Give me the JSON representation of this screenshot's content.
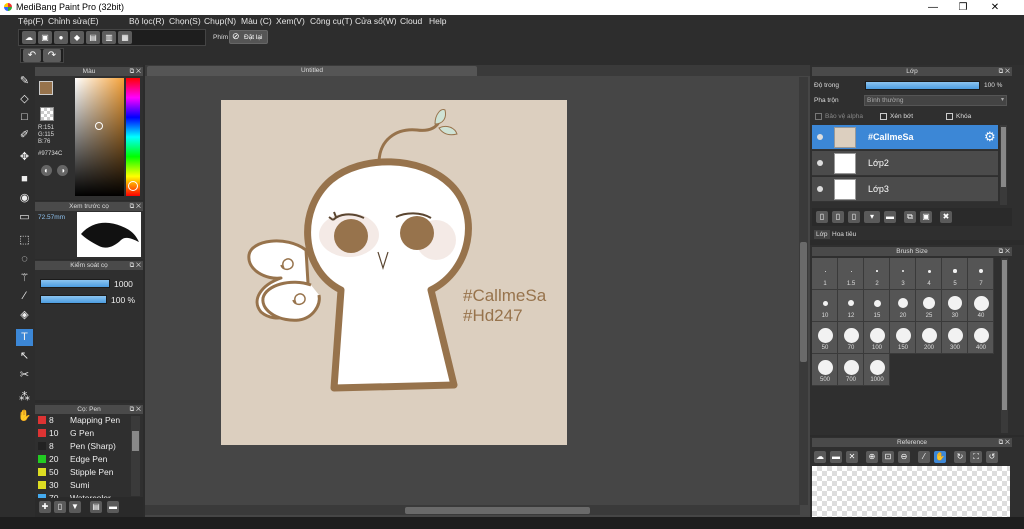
{
  "window": {
    "title": "MediBang Paint Pro (32bit)",
    "minimize": "—",
    "maximize": "❐",
    "close": "✕"
  },
  "menu": [
    "Tệp(F)",
    "Chỉnh sửa(E)",
    "Bộ lọc(R)",
    "Chọn(S)",
    "Chụp(N)",
    "Màu (C)",
    "Xem(V)",
    "Công cụ(T)",
    "Cửa sổ(W)",
    "Cloud",
    "Help"
  ],
  "toolbar": {
    "brush_key_label": "Phím",
    "reset_label": "Đặt lại"
  },
  "color_panel": {
    "title": "Màu",
    "rgb": [
      "R:151",
      "G:115",
      "B:76"
    ],
    "hex": "#97734C",
    "color": "#97734C"
  },
  "preview_panel": {
    "title": "Xem trước cọ",
    "size": "72.57mm"
  },
  "brush_control": {
    "title": "Kiểm soát cọ",
    "size": "1000",
    "opacity": "100 %"
  },
  "brush_list": {
    "title": "Cọ: Pen",
    "items": [
      {
        "num": "8",
        "name": "Mapping Pen",
        "color": "#d33"
      },
      {
        "num": "10",
        "name": "G Pen",
        "color": "#d33"
      },
      {
        "num": "8",
        "name": "Pen (Sharp)",
        "color": "#222"
      },
      {
        "num": "20",
        "name": "Edge Pen",
        "color": "#2c2"
      },
      {
        "num": "50",
        "name": "Stipple Pen",
        "color": "#dd2"
      },
      {
        "num": "30",
        "name": "Sumi",
        "color": "#dd2"
      },
      {
        "num": "70",
        "name": "Watercolor",
        "color": "#4ae"
      }
    ]
  },
  "canvas": {
    "tab": "Untitled",
    "text1": "#CallmeSa",
    "text2": "#Hd247",
    "bg": "#dccfbf",
    "ink": "#97734C"
  },
  "layer_panel": {
    "title": "Lớp",
    "opacity_label": "Độ trong",
    "opacity_value": "100 %",
    "blend_label": "Pha trộn",
    "blend_value": "Bình thường",
    "protect_alpha": "Bảo vệ alpha",
    "clipping": "Xén bớt",
    "lock": "Khóa",
    "layers": [
      "#CallmeSa",
      "Lớp2",
      "Lớp3"
    ],
    "tabs": [
      "Lớp",
      "Hoa tiêu"
    ]
  },
  "brush_size": {
    "title": "Brush Size",
    "sizes": [
      "1",
      "1.5",
      "2",
      "3",
      "4",
      "5",
      "7",
      "10",
      "12",
      "15",
      "20",
      "25",
      "30",
      "40",
      "50",
      "70",
      "100",
      "150",
      "200",
      "300",
      "400",
      "500",
      "700",
      "1000"
    ]
  },
  "reference": {
    "title": "Reference"
  }
}
